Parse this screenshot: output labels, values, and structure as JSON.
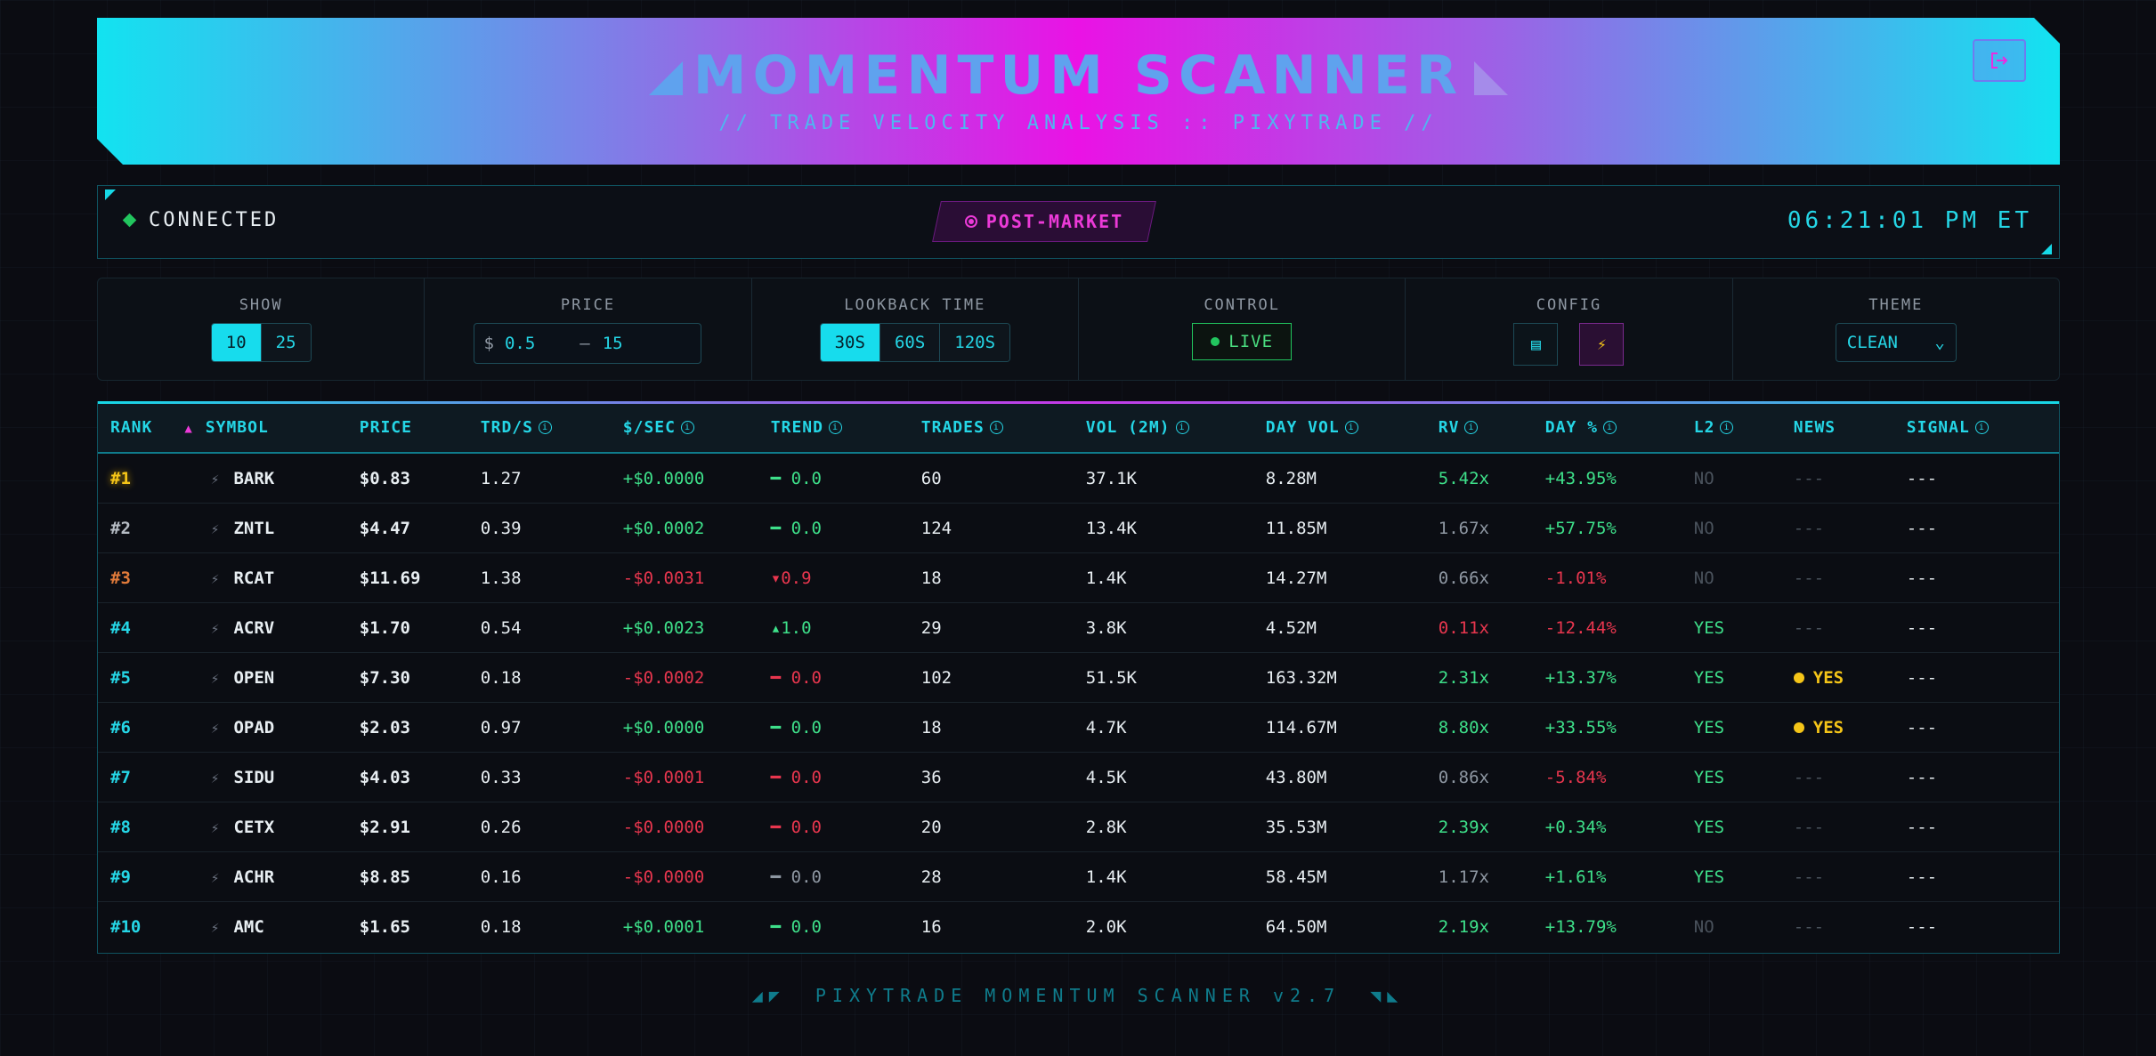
{
  "header": {
    "title": "MOMENTUM SCANNER",
    "subtitle": "// TRADE VELOCITY ANALYSIS :: PIXYTRADE //",
    "logout_icon": "logout-icon"
  },
  "status": {
    "connection": "CONNECTED",
    "market_session": "POST-MARKET",
    "clock": "06:21:01 PM ET"
  },
  "controls": {
    "show": {
      "label": "SHOW",
      "options": [
        "10",
        "25"
      ],
      "selected": "10"
    },
    "price": {
      "label": "PRICE",
      "currency": "$",
      "min": "0.5",
      "separator": "–",
      "max": "15"
    },
    "lookback": {
      "label": "LOOKBACK TIME",
      "options": [
        "30S",
        "60S",
        "120S"
      ],
      "selected": "30S"
    },
    "control": {
      "label": "CONTROL",
      "live_label": "LIVE"
    },
    "config": {
      "label": "CONFIG",
      "icons": [
        "list-icon",
        "bolt-icon"
      ]
    },
    "theme": {
      "label": "THEME",
      "value": "CLEAN"
    }
  },
  "table": {
    "columns": [
      "RANK",
      "SYMBOL",
      "PRICE",
      "TRD/S",
      "$/SEC",
      "TREND",
      "TRADES",
      "VOL (2M)",
      "DAY VOL",
      "RV",
      "DAY %",
      "L2",
      "NEWS",
      "SIGNAL"
    ],
    "rows": [
      {
        "rank": "#1",
        "symbol": "BARK",
        "price": "$0.83",
        "trds": "1.27",
        "sec": "+$0.0000",
        "trend": "━ 0.0",
        "trades": "60",
        "vol2m": "37.1K",
        "dayvol": "8.28M",
        "rv": "5.42x",
        "dayp": "+43.95%",
        "l2": "NO",
        "news": "---",
        "signal": "---"
      },
      {
        "rank": "#2",
        "symbol": "ZNTL",
        "price": "$4.47",
        "trds": "0.39",
        "sec": "+$0.0002",
        "trend": "━ 0.0",
        "trades": "124",
        "vol2m": "13.4K",
        "dayvol": "11.85M",
        "rv": "1.67x",
        "dayp": "+57.75%",
        "l2": "NO",
        "news": "---",
        "signal": "---"
      },
      {
        "rank": "#3",
        "symbol": "RCAT",
        "price": "$11.69",
        "trds": "1.38",
        "sec": "-$0.0031",
        "trend": "▾0.9",
        "trades": "18",
        "vol2m": "1.4K",
        "dayvol": "14.27M",
        "rv": "0.66x",
        "dayp": "-1.01%",
        "l2": "NO",
        "news": "---",
        "signal": "---"
      },
      {
        "rank": "#4",
        "symbol": "ACRV",
        "price": "$1.70",
        "trds": "0.54",
        "sec": "+$0.0023",
        "trend": "▴1.0",
        "trades": "29",
        "vol2m": "3.8K",
        "dayvol": "4.52M",
        "rv": "0.11x",
        "dayp": "-12.44%",
        "l2": "YES",
        "news": "---",
        "signal": "---"
      },
      {
        "rank": "#5",
        "symbol": "OPEN",
        "price": "$7.30",
        "trds": "0.18",
        "sec": "-$0.0002",
        "trend": "━ 0.0",
        "trades": "102",
        "vol2m": "51.5K",
        "dayvol": "163.32M",
        "rv": "2.31x",
        "dayp": "+13.37%",
        "l2": "YES",
        "news": "YES",
        "signal": "---"
      },
      {
        "rank": "#6",
        "symbol": "OPAD",
        "price": "$2.03",
        "trds": "0.97",
        "sec": "+$0.0000",
        "trend": "━ 0.0",
        "trades": "18",
        "vol2m": "4.7K",
        "dayvol": "114.67M",
        "rv": "8.80x",
        "dayp": "+33.55%",
        "l2": "YES",
        "news": "YES",
        "signal": "---"
      },
      {
        "rank": "#7",
        "symbol": "SIDU",
        "price": "$4.03",
        "trds": "0.33",
        "sec": "-$0.0001",
        "trend": "━ 0.0",
        "trades": "36",
        "vol2m": "4.5K",
        "dayvol": "43.80M",
        "rv": "0.86x",
        "dayp": "-5.84%",
        "l2": "YES",
        "news": "---",
        "signal": "---"
      },
      {
        "rank": "#8",
        "symbol": "CETX",
        "price": "$2.91",
        "trds": "0.26",
        "sec": "-$0.0000",
        "trend": "━ 0.0",
        "trades": "20",
        "vol2m": "2.8K",
        "dayvol": "35.53M",
        "rv": "2.39x",
        "dayp": "+0.34%",
        "l2": "YES",
        "news": "---",
        "signal": "---"
      },
      {
        "rank": "#9",
        "symbol": "ACHR",
        "price": "$8.85",
        "trds": "0.16",
        "sec": "-$0.0000",
        "trend": "━ 0.0",
        "trades": "28",
        "vol2m": "1.4K",
        "dayvol": "58.45M",
        "rv": "1.17x",
        "dayp": "+1.61%",
        "l2": "YES",
        "news": "---",
        "signal": "---"
      },
      {
        "rank": "#10",
        "symbol": "AMC",
        "price": "$1.65",
        "trds": "0.18",
        "sec": "+$0.0001",
        "trend": "━ 0.0",
        "trades": "16",
        "vol2m": "2.0K",
        "dayvol": "64.50M",
        "rv": "2.19x",
        "dayp": "+13.79%",
        "l2": "NO",
        "news": "---",
        "signal": "---"
      }
    ]
  },
  "footer": {
    "text": "PIXYTRADE MOMENTUM SCANNER v2.7"
  }
}
